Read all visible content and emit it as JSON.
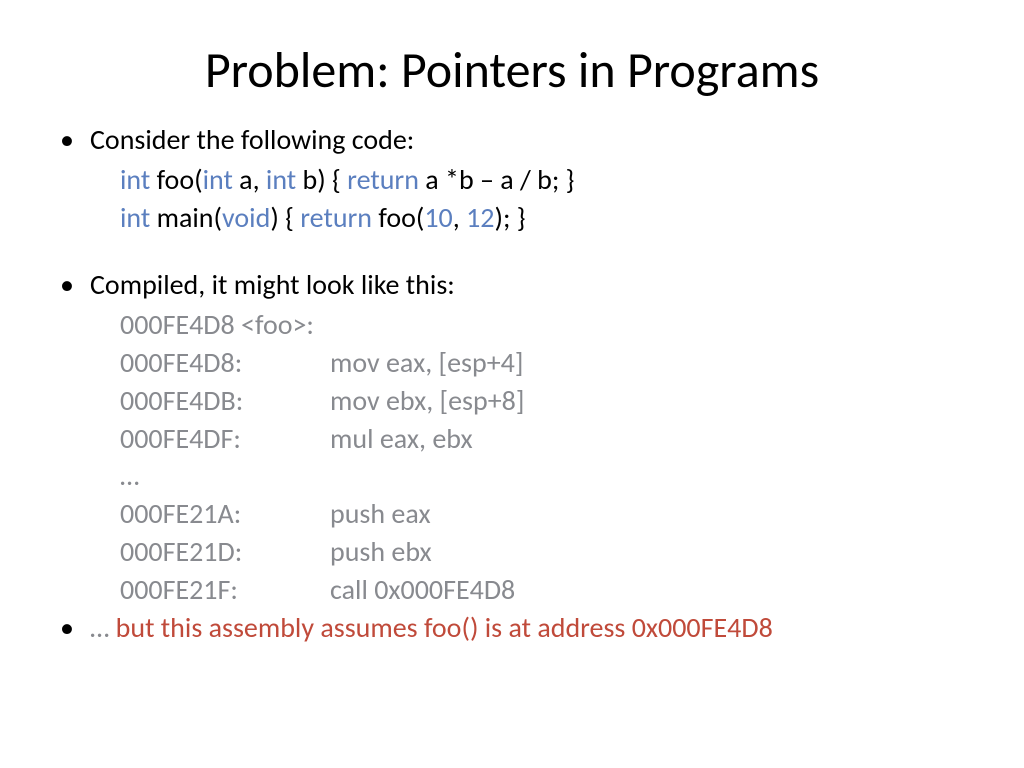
{
  "title": "Problem: Pointers in Programs",
  "b1": "Consider the following code:",
  "code1": {
    "kw_int1": "int",
    "foo": " foo(",
    "kw_int2": "int",
    "a": " a, ",
    "kw_int3": "int",
    "b": " b) { ",
    "kw_return1": "return",
    "expr": " a *b – a / b; }"
  },
  "code2": {
    "kw_int": "int",
    "main": " main(",
    "kw_void": "void",
    "mid": ") { ",
    "kw_return": "return",
    "foo": " foo(",
    "n1": "10",
    "comma": ", ",
    "n2": "12",
    "end": "); }"
  },
  "b2": "Compiled, it might look like this:",
  "asm": [
    {
      "addr": "000FE4D8 <foo>:",
      "ins": ""
    },
    {
      "addr": "000FE4D8:",
      "ins": "mov eax, [esp+4]"
    },
    {
      "addr": "000FE4DB:",
      "ins": "mov ebx, [esp+8]"
    },
    {
      "addr": "000FE4DF:",
      "ins": "mul eax, ebx"
    },
    {
      "addr": "…",
      "ins": ""
    },
    {
      "addr": "000FE21A:",
      "ins": "push eax"
    },
    {
      "addr": "000FE21D:",
      "ins": "push ebx"
    },
    {
      "addr": "000FE21F:",
      "ins": "call 0x000FE4D8"
    }
  ],
  "b3_prefix": "… ",
  "b3": "but this assembly assumes foo() is at address 0x000FE4D8"
}
